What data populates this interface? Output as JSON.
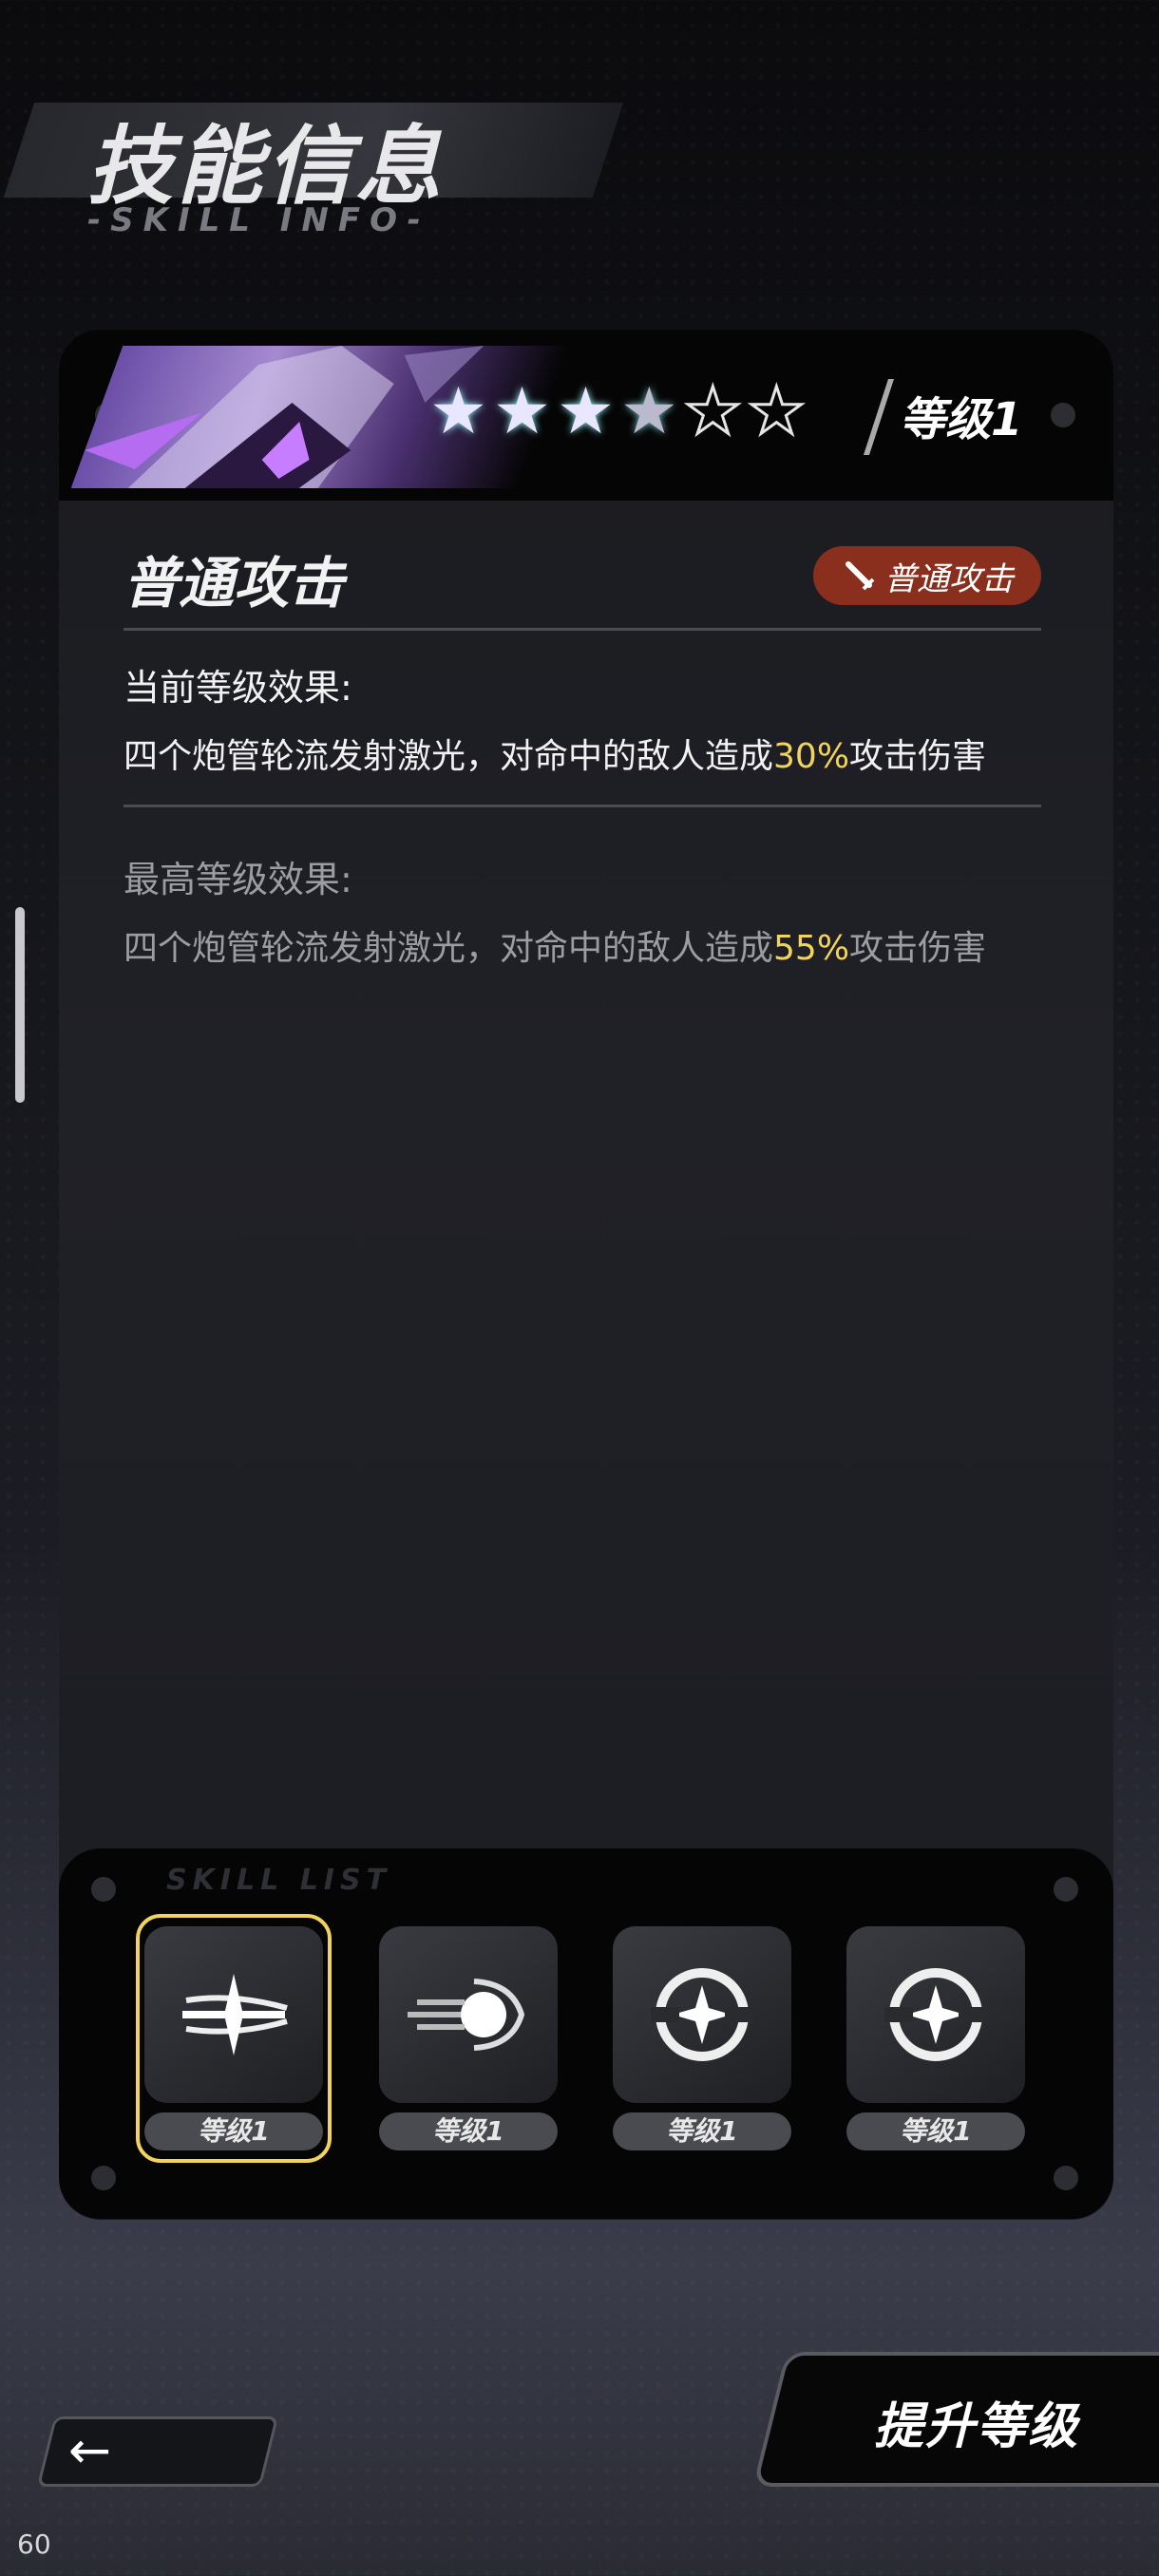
{
  "header": {
    "title": "技能信息",
    "subtitle": "-SKILL INFO-"
  },
  "skill": {
    "level_label": "等级1",
    "stars": {
      "filled": 3.5,
      "total": 6
    },
    "name": "普通攻击",
    "type_badge": "普通攻击",
    "current_label": "当前等级效果:",
    "current_desc_prefix": "四个炮管轮流发射激光，对命中的敌人造成",
    "current_value": "30%",
    "current_desc_suffix": "攻击伤害",
    "max_label": "最高等级效果:",
    "max_desc_prefix": "四个炮管轮流发射激光，对命中的敌人造成",
    "max_value": "55%",
    "max_desc_suffix": "攻击伤害"
  },
  "skill_list": {
    "tag": "SKILL LIST",
    "items": [
      {
        "icon": "triple-blade-icon",
        "level": "等级1",
        "selected": true
      },
      {
        "icon": "energy-orb-icon",
        "level": "等级1",
        "selected": false
      },
      {
        "icon": "ring-star-icon",
        "level": "等级1",
        "selected": false
      },
      {
        "icon": "ring-star-icon",
        "level": "等级1",
        "selected": false
      }
    ]
  },
  "buttons": {
    "upgrade": "提升等级",
    "back": "←"
  },
  "fps": "60",
  "colors": {
    "highlight": "#f2d45c",
    "badge": "#8a2f1d",
    "panel": "#1c1d22"
  }
}
